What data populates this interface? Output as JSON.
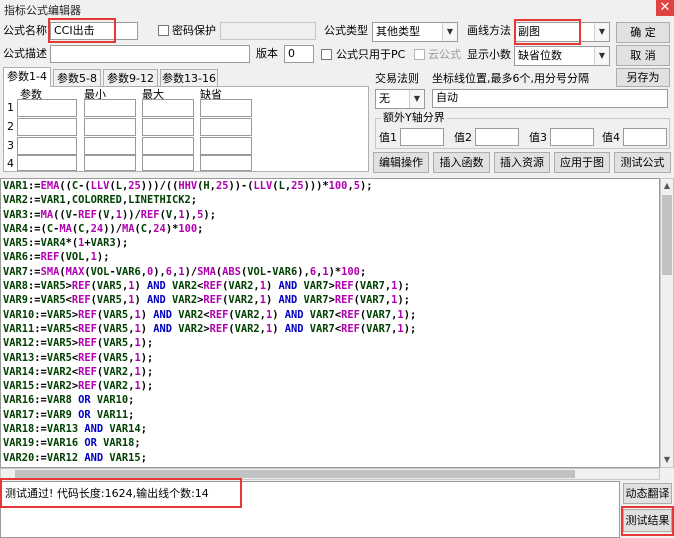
{
  "window": {
    "title": "指标公式编辑器",
    "close_glyph": "✕"
  },
  "form": {
    "name_label": "公式名称",
    "name_value": "CCI出击",
    "name_extra_value": "",
    "password_label": "密码保护",
    "password_value": "",
    "type_label": "公式类型",
    "type_value": "其他类型",
    "draw_label": "画线方法",
    "draw_value": "副图",
    "desc_label": "公式描述",
    "desc_value": "",
    "version_label": "版本",
    "version_value": "0",
    "pc_only_label": "公式只用于PC",
    "cloud_label": "云公式",
    "decimals_label": "显示小数",
    "decimals_value": "缺省位数"
  },
  "buttons": {
    "ok": "确  定",
    "cancel": "取  消",
    "save_as": "另存为",
    "edit_ops": "编辑操作",
    "insert_func": "插入函数",
    "insert_res": "插入资源",
    "apply_chart": "应用于图",
    "test_formula": "测试公式",
    "dynamic_translate": "动态翻译",
    "test_result": "测试结果"
  },
  "tabs": [
    "参数1-4",
    "参数5-8",
    "参数9-12",
    "参数13-16"
  ],
  "params": {
    "headers": [
      "参数",
      "最小",
      "最大",
      "缺省"
    ],
    "rows": [
      {
        "index": "1",
        "name": "",
        "min": "",
        "max": "",
        "default": ""
      },
      {
        "index": "2",
        "name": "",
        "min": "",
        "max": "",
        "default": ""
      },
      {
        "index": "3",
        "name": "",
        "min": "",
        "max": "",
        "default": ""
      },
      {
        "index": "4",
        "name": "",
        "min": "",
        "max": "",
        "default": ""
      }
    ]
  },
  "trade": {
    "label": "交易法则",
    "value": "无"
  },
  "coords": {
    "label": "坐标线位置,最多6个,用分号分隔",
    "value": "自动"
  },
  "yaxis": {
    "label": "额外Y轴分界",
    "fields": [
      {
        "label": "值1",
        "value": ""
      },
      {
        "label": "值2",
        "value": ""
      },
      {
        "label": "值3",
        "value": ""
      },
      {
        "label": "值4",
        "value": ""
      }
    ]
  },
  "code_lines": [
    "VAR1:=EMA((C-(LLV(L,25)))/((HHV(H,25))-(LLV(L,25)))*100,5);",
    "VAR2:=VAR1,COLORRED,LINETHICK2;",
    "VAR3:=MA((V-REF(V,1))/REF(V,1),5);",
    "VAR4:=(C-MA(C,24))/MA(C,24)*100;",
    "VAR5:=VAR4*(1+VAR3);",
    "VAR6:=REF(VOL,1);",
    "VAR7:=SMA(MAX(VOL-VAR6,0),6,1)/SMA(ABS(VOL-VAR6),6,1)*100;",
    "VAR8:=VAR5>REF(VAR5,1) AND VAR2<REF(VAR2,1) AND VAR7>REF(VAR7,1);",
    "VAR9:=VAR5<REF(VAR5,1) AND VAR2>REF(VAR2,1) AND VAR7>REF(VAR7,1);",
    "VAR10:=VAR5>REF(VAR5,1) AND VAR2<REF(VAR2,1) AND VAR7<REF(VAR7,1);",
    "VAR11:=VAR5<REF(VAR5,1) AND VAR2>REF(VAR2,1) AND VAR7<REF(VAR7,1);",
    "VAR12:=VAR5>REF(VAR5,1);",
    "VAR13:=VAR5<REF(VAR5,1);",
    "VAR14:=VAR2<REF(VAR2,1);",
    "VAR15:=VAR2>REF(VAR2,1);",
    "VAR16:=VAR8 OR VAR10;",
    "VAR17:=VAR9 OR VAR11;",
    "VAR18:=VAR13 AND VAR14;",
    "VAR19:=VAR16 OR VAR18;",
    "VAR20:=VAR12 AND VAR15;"
  ],
  "output": {
    "text": "测试通过! 代码长度:1624,输出线个数:14"
  },
  "colors": {
    "identifier": "#004000",
    "function": "#b000b0",
    "number": "#b000b0",
    "keyword": "#0000c0",
    "operator": "#000000",
    "highlight": "#e53935"
  }
}
